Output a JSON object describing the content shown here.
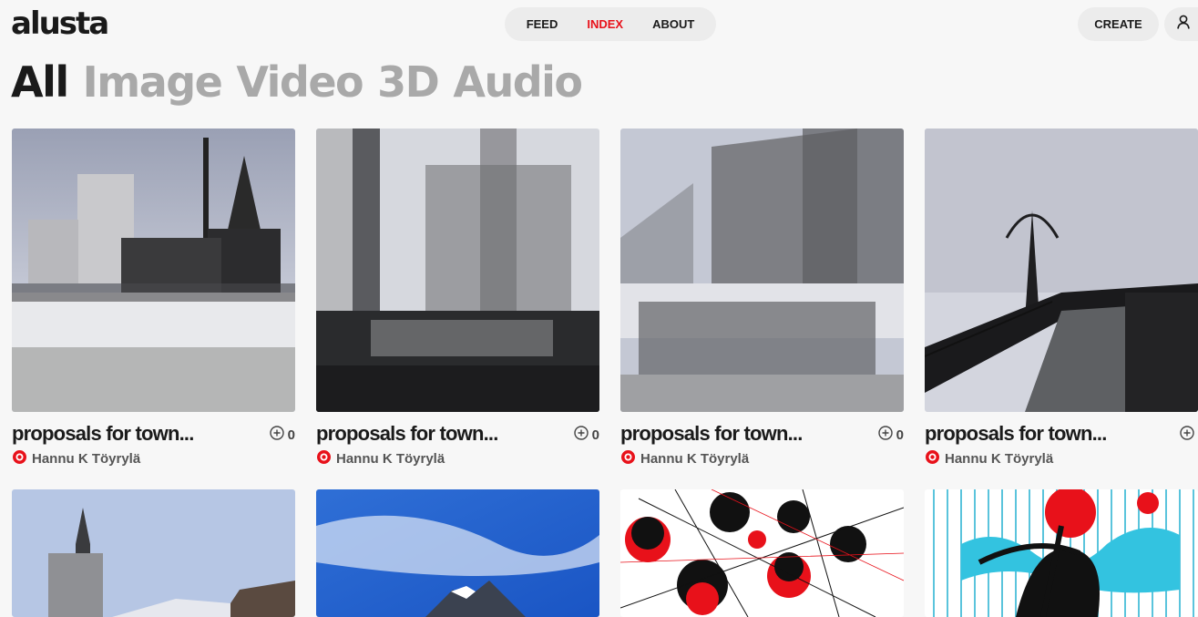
{
  "header": {
    "logo": "alusta",
    "nav": [
      "FEED",
      "INDEX",
      "ABOUT"
    ],
    "active_nav": "INDEX",
    "create_label": "CREATE",
    "icons": {
      "user": "user-icon"
    }
  },
  "filters": {
    "items": [
      "All",
      "Image",
      "Video",
      "3D",
      "Audio"
    ],
    "active": "All"
  },
  "colors": {
    "accent": "#e8111a",
    "text": "#1a1a1a",
    "muted": "#a9a9a9",
    "pill_bg": "#ececec",
    "page_bg": "#f7f7f7"
  },
  "cards": [
    {
      "title": "proposals for town...",
      "author": "Hannu K Töyrylä",
      "collect_count": "0"
    },
    {
      "title": "proposals for town...",
      "author": "Hannu K Töyrylä",
      "collect_count": "0"
    },
    {
      "title": "proposals for town...",
      "author": "Hannu K Töyrylä",
      "collect_count": "0"
    },
    {
      "title": "proposals for town...",
      "author": "Hannu K Töyrylä",
      "collect_count": ""
    }
  ],
  "card_icons": {
    "collect": "plus-circle-icon",
    "author_badge": "author-badge-icon"
  }
}
